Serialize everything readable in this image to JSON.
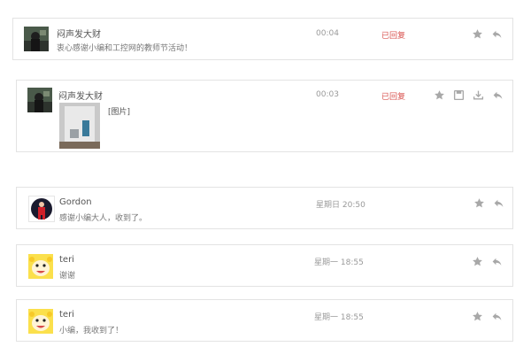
{
  "messages": [
    {
      "name": "闷声发大财",
      "text": "衷心感谢小编和工控网的教师节活动！",
      "time": "00:04",
      "status": "已回复"
    },
    {
      "name": "闷声发大财",
      "text": "[图片]",
      "time": "00:03",
      "status": "已回复"
    },
    {
      "name": "Gordon",
      "text": "感谢小编大人，收到了。",
      "time": "星期日 20:50",
      "status": ""
    },
    {
      "name": "teri",
      "text": "谢谢",
      "time": "星期一 18:55",
      "status": ""
    },
    {
      "name": "teri",
      "text": "小编，我收到了！",
      "time": "星期一 18:55",
      "status": ""
    }
  ],
  "icons": {
    "star": "star-icon",
    "reply": "reply-icon",
    "save": "save-icon",
    "download": "download-icon"
  }
}
